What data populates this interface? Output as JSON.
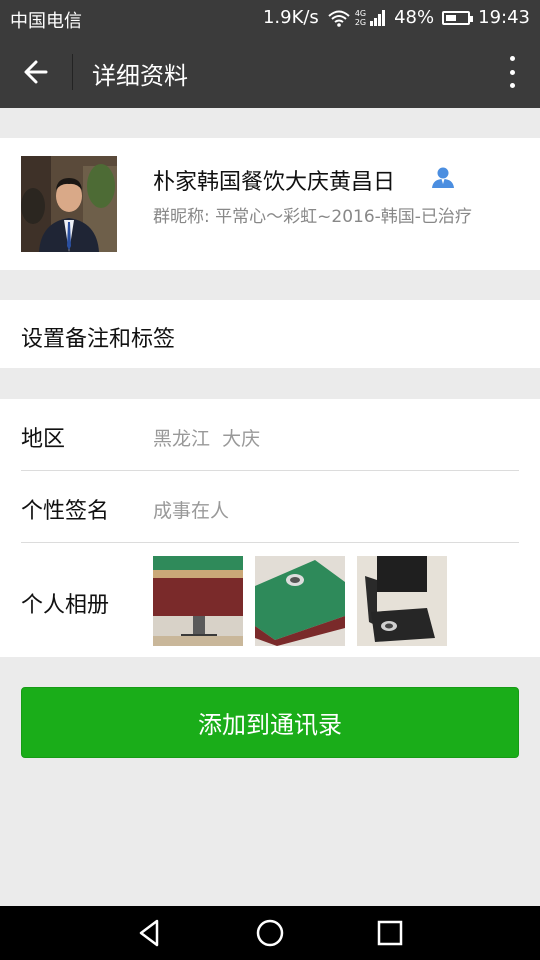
{
  "status_bar": {
    "carrier": "中国电信",
    "speed": "1.9K/s",
    "net_type_top": "4G",
    "net_type_bottom": "2G",
    "battery": "48%",
    "battery_level": 0.48,
    "time": "19:43"
  },
  "header": {
    "title": "详细资料",
    "back_icon": "arrow-left-icon",
    "more_icon": "more-vertical-icon"
  },
  "profile": {
    "name": "朴家韩国餐饮大庆黄昌日",
    "nickname": "群昵称: 平常心～彩虹~2016-韩国-已治疗",
    "badge_icon": "person-icon",
    "badge_color": "#4b8ee0"
  },
  "remark": {
    "label": "设置备注和标签"
  },
  "details": {
    "region_label": "地区",
    "region_value": "黑龙江  大庆",
    "signature_label": "个性签名",
    "signature_value": "成事在人",
    "album_label": "个人相册"
  },
  "add_button": {
    "label": "添加到通讯录",
    "color": "#1aad19"
  },
  "nav": {
    "back_icon": "triangle-back-icon",
    "home_icon": "circle-home-icon",
    "recents_icon": "square-recents-icon"
  }
}
